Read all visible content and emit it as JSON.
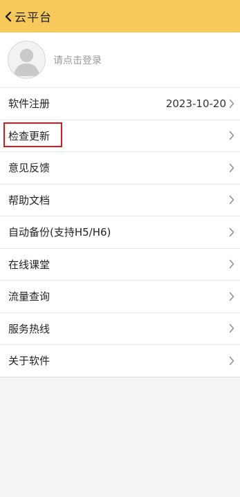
{
  "header": {
    "back_icon": "chevron-left-icon",
    "title": "云平台",
    "background": "#f7c95a"
  },
  "profile": {
    "avatar_icon": "user-avatar-icon",
    "login_text": "请点击登录"
  },
  "menu": {
    "items": [
      {
        "label": "软件注册",
        "value": "2023-10-20"
      },
      {
        "label": "检查更新",
        "value": ""
      },
      {
        "label": "意见反馈",
        "value": ""
      },
      {
        "label": "帮助文档",
        "value": ""
      },
      {
        "label": "自动备份(支持H5/H6)",
        "value": ""
      },
      {
        "label": "在线课堂",
        "value": ""
      },
      {
        "label": "流量查询",
        "value": ""
      },
      {
        "label": "服务热线",
        "value": ""
      },
      {
        "label": "关于软件",
        "value": ""
      }
    ],
    "chevron_icon": "chevron-right-icon",
    "highlight_color": "#d71920"
  }
}
